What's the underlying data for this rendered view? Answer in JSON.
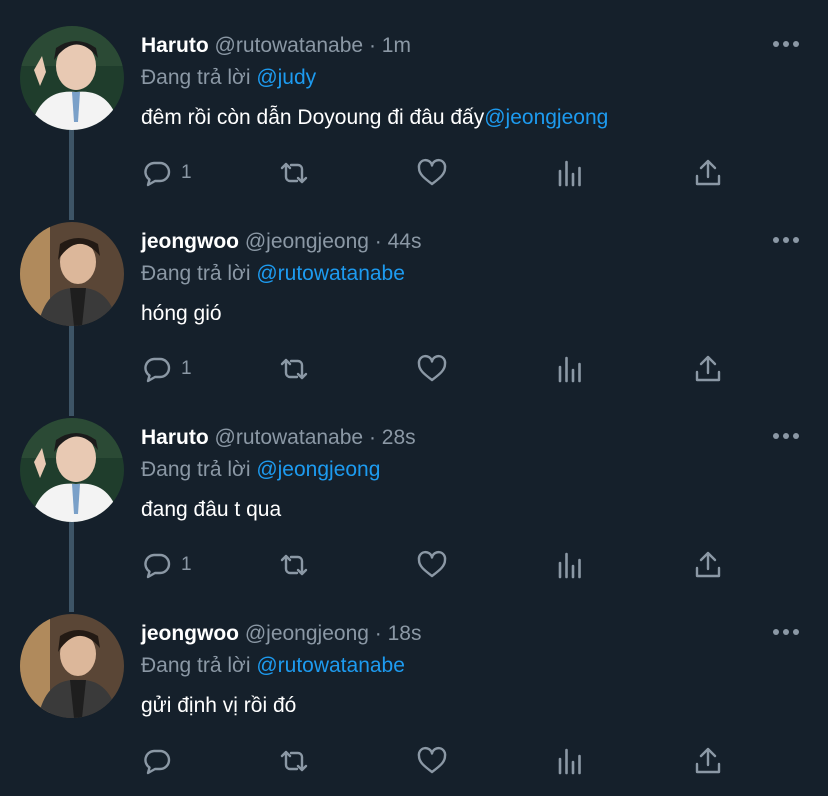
{
  "tweets": [
    {
      "name": "Haruto",
      "handle": "@rutowatanabe",
      "separator": "·",
      "time": "1m",
      "reply_prefix": "Đang trả lời",
      "reply_to": "@judy",
      "text": "đêm rồi còn dẫn Doyoung đi đâu đấy",
      "text_mention": "@jeongjeong",
      "reply_count": "1",
      "avatar": "haruto-avatar"
    },
    {
      "name": "jeongwoo",
      "handle": "@jeongjeong",
      "separator": "·",
      "time": "44s",
      "reply_prefix": "Đang trả lời",
      "reply_to": "@rutowatanabe",
      "text": "hóng gió",
      "text_mention": "",
      "reply_count": "1",
      "avatar": "jeongwoo-avatar"
    },
    {
      "name": "Haruto",
      "handle": "@rutowatanabe",
      "separator": "·",
      "time": "28s",
      "reply_prefix": "Đang trả lời",
      "reply_to": "@jeongjeong",
      "text": "đang đâu t qua",
      "text_mention": "",
      "reply_count": "1",
      "avatar": "haruto-avatar"
    },
    {
      "name": "jeongwoo",
      "handle": "@jeongjeong",
      "separator": "·",
      "time": "18s",
      "reply_prefix": "Đang trả lời",
      "reply_to": "@rutowatanabe",
      "text": "gửi định vị rồi đó",
      "text_mention": "",
      "reply_count": "",
      "avatar": "jeongwoo-avatar"
    }
  ],
  "icons": {
    "more": "more-dots-icon",
    "reply": "reply-bubble-icon",
    "retweet": "retweet-icon",
    "like": "heart-icon",
    "analytics": "analytics-bars-icon",
    "share": "share-upload-icon"
  },
  "colors": {
    "background": "#15202b",
    "mention": "#1d9bf0",
    "muted": "#8b98a5",
    "thread_line": "#3d5466"
  }
}
